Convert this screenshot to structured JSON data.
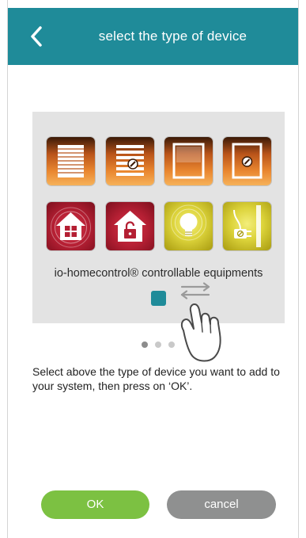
{
  "header": {
    "title": "select the type of device",
    "back_icon": "chevron-left-icon",
    "background_color": "#1f8b99"
  },
  "device_panel": {
    "tiles": [
      {
        "icon": "roller-shutter-icon",
        "color": "orange"
      },
      {
        "icon": "venetian-blind-icon",
        "color": "orange"
      },
      {
        "icon": "awning-icon",
        "color": "orange"
      },
      {
        "icon": "window-icon",
        "color": "orange"
      },
      {
        "icon": "house-alarm-icon",
        "color": "red"
      },
      {
        "icon": "garage-door-icon",
        "color": "red"
      },
      {
        "icon": "light-bulb-icon",
        "color": "yellow"
      },
      {
        "icon": "power-plug-icon",
        "color": "yellow"
      }
    ],
    "category_label": "io-homecontrol® controllable equipments",
    "swipe_hint_icons": [
      "swap-arrows-icon",
      "hand-swipe-icon"
    ]
  },
  "pagination": {
    "total": 3,
    "active_index": 0
  },
  "instruction": "Select above the type of device you want to add to your system, then press on ‘OK’.",
  "buttons": {
    "ok_label": "OK",
    "cancel_label": "cancel",
    "ok_color": "#7cc142",
    "cancel_color": "#8f9090"
  }
}
